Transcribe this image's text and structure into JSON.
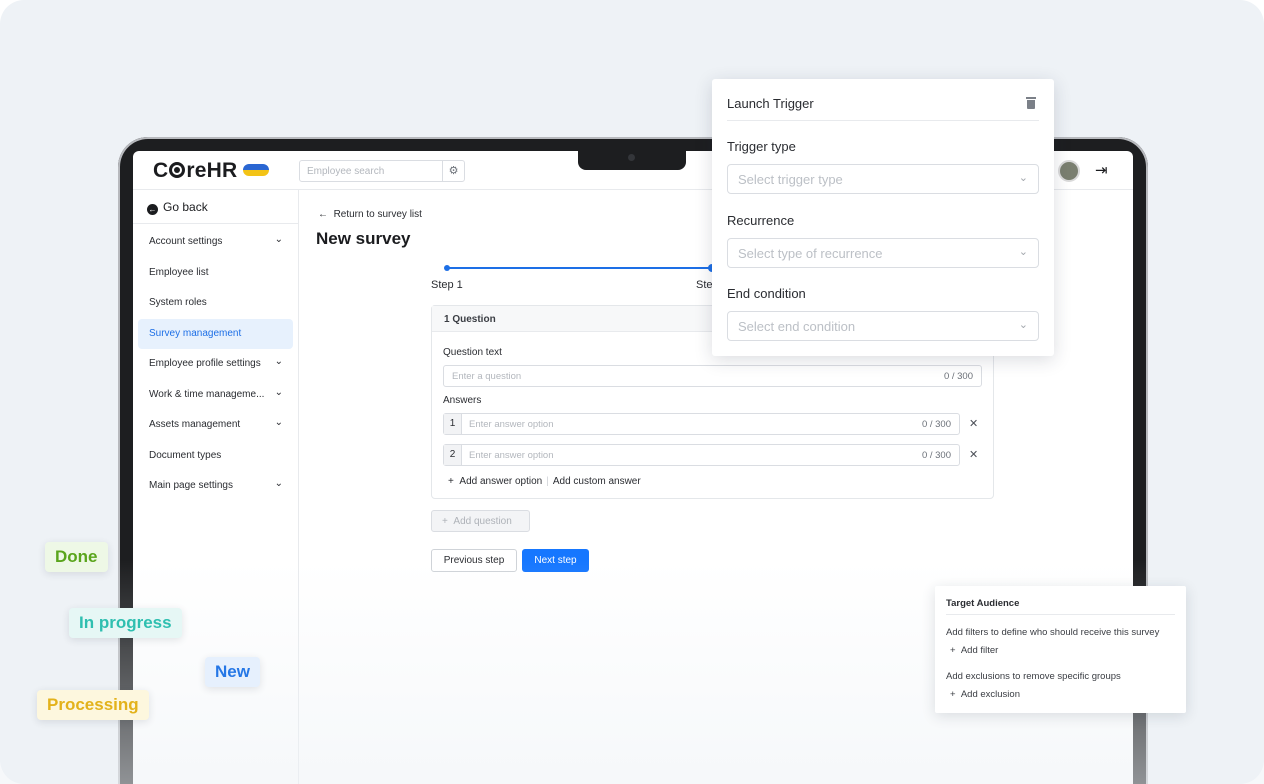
{
  "header": {
    "logo_text_pre": "C",
    "logo_text_post": "reHR",
    "search_placeholder": "Employee search",
    "filter_icon": "sliders-icon",
    "logout_icon": "logout-icon"
  },
  "sidebar": {
    "go_back": "Go back",
    "items": [
      {
        "label": "Account settings",
        "chevron": "⌄"
      },
      {
        "label": "Employee list",
        "chevron": ""
      },
      {
        "label": "System roles",
        "chevron": ""
      },
      {
        "label": "Survey management",
        "chevron": ""
      },
      {
        "label": "Employee profile settings",
        "chevron": "⌄"
      },
      {
        "label": "Work & time manageme...",
        "chevron": "⌄"
      },
      {
        "label": "Assets management",
        "chevron": "⌄"
      },
      {
        "label": "Document types",
        "chevron": ""
      },
      {
        "label": "Main page settings",
        "chevron": "⌄"
      }
    ]
  },
  "main": {
    "back_link": "Return to survey list",
    "title": "New survey",
    "steps": [
      "Step 1",
      "Ste"
    ],
    "question_header": "1 Question",
    "question_text_label": "Question text",
    "question_placeholder": "Enter a question",
    "question_count": "0 / 300",
    "answers_label": "Answers",
    "answers": [
      {
        "num": "1",
        "placeholder": "Enter answer option",
        "count": "0 / 300"
      },
      {
        "num": "2",
        "placeholder": "Enter answer option",
        "count": "0 / 300"
      }
    ],
    "add_answer_option": "Add answer option",
    "add_custom_answer": "Add custom answer",
    "add_question": "Add question",
    "previous_step": "Previous step",
    "next_step": "Next step"
  },
  "launch_trigger": {
    "title": "Launch Trigger",
    "trigger_type_label": "Trigger type",
    "trigger_type_placeholder": "Select trigger type",
    "recurrence_label": "Recurrence",
    "recurrence_placeholder": "Select type of recurrence",
    "end_condition_label": "End condition",
    "end_condition_placeholder": "Select end condition"
  },
  "target_audience": {
    "title": "Target Audience",
    "filters_text": "Add filters to define who should receive this survey",
    "add_filter": "Add filter",
    "exclusions_text": "Add exclusions to remove specific groups",
    "add_exclusion": "Add exclusion"
  },
  "badges": {
    "done": "Done",
    "in_progress": "In progress",
    "new": "New",
    "processing": "Processing"
  },
  "colors": {
    "accent": "#1677ff",
    "done": "#5aa51c",
    "in_progress": "#2fbfb0",
    "new": "#2577e6",
    "processing": "#e3b21b"
  }
}
